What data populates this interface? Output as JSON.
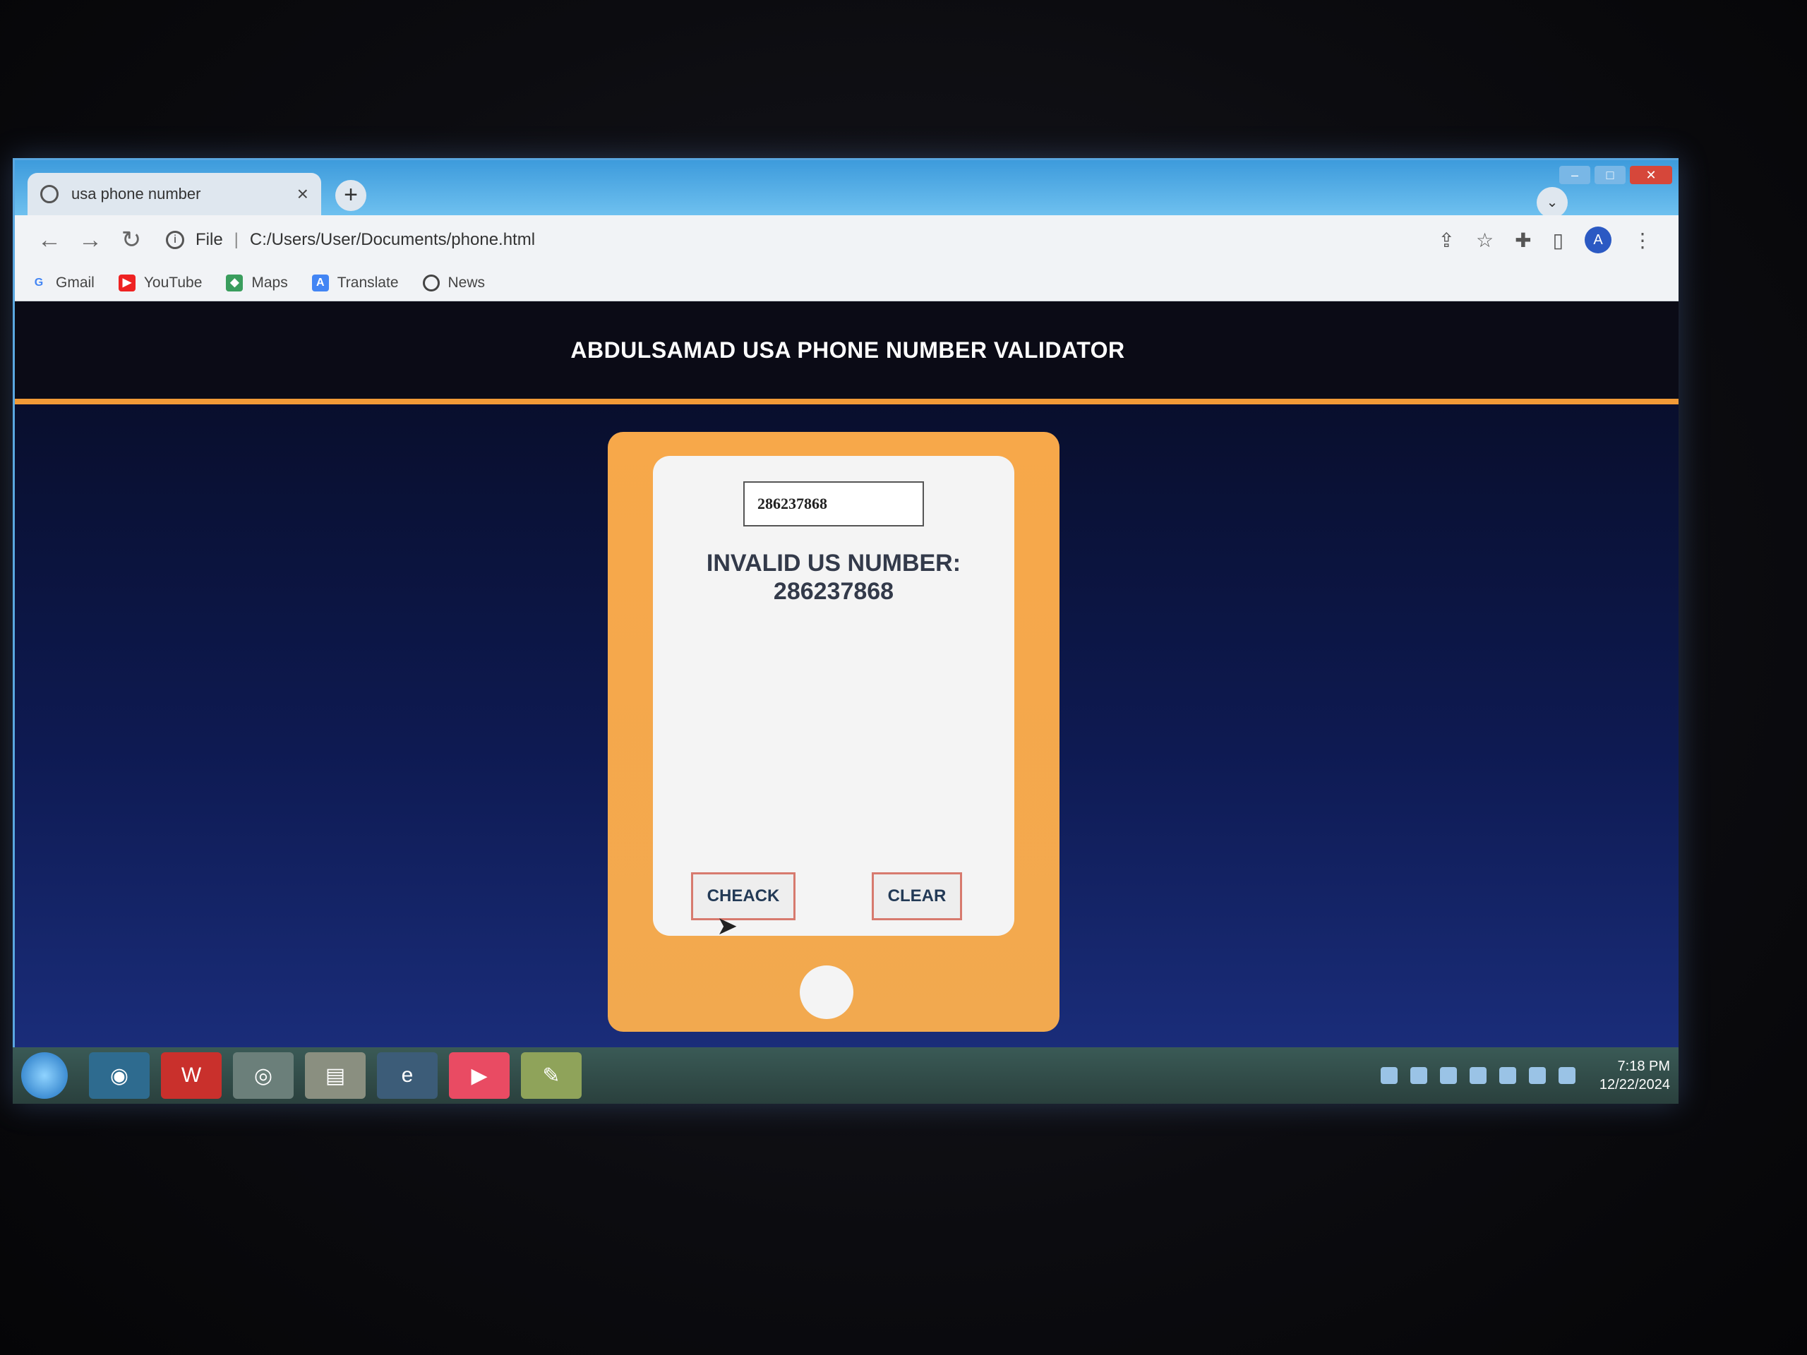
{
  "browser": {
    "tab_title": "usa phone number",
    "url_prefix": "File",
    "url": "C:/Users/User/Documents/phone.html",
    "bookmarks": [
      {
        "label": "Gmail",
        "icon": "google-icon"
      },
      {
        "label": "YouTube",
        "icon": "youtube-icon"
      },
      {
        "label": "Maps",
        "icon": "maps-icon"
      },
      {
        "label": "Translate",
        "icon": "translate-icon"
      },
      {
        "label": "News",
        "icon": "news-icon"
      }
    ],
    "avatar_letter": "A"
  },
  "page": {
    "header_title": "ABDULSAMAD USA PHONE NUMBER VALIDATOR",
    "input_value": "286237868",
    "result_line1": "INVALID US NUMBER:",
    "result_line2": "286237868",
    "check_label": "CHEACK",
    "clear_label": "CLEAR",
    "accent_color": "#f19a37"
  },
  "taskbar": {
    "time": "7:18 PM",
    "date": "12/22/2024"
  }
}
